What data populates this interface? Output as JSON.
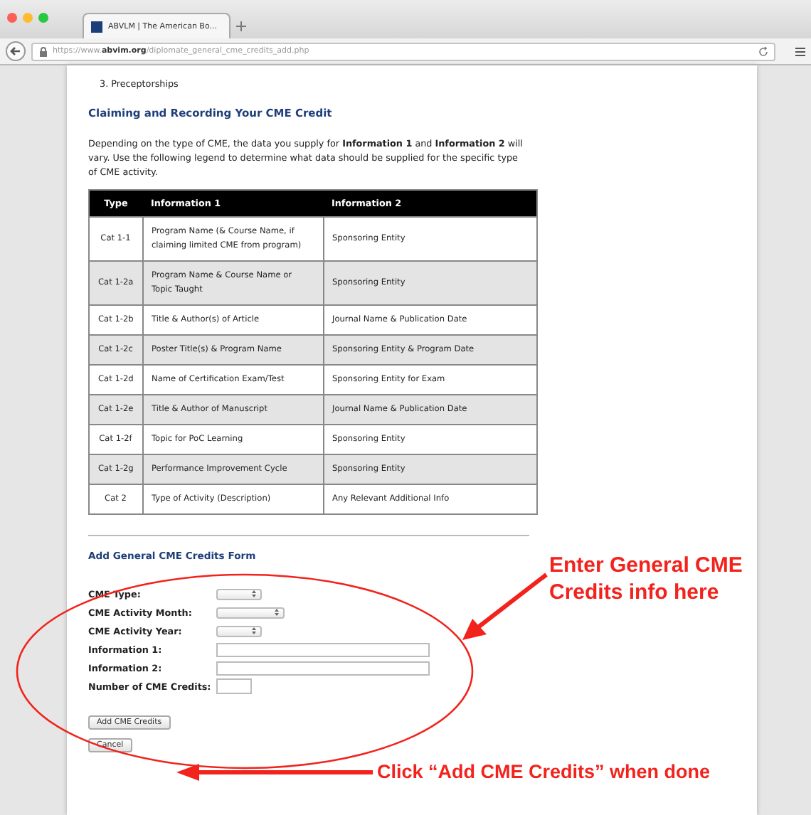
{
  "browser": {
    "tab_title": "ABVLM | The American Bo...",
    "url": "https://www.**abvim.org**/diplomate_general_cme_credits_add.php"
  },
  "page": {
    "list_item": "3. Preceptorships",
    "heading": "Claiming and Recording Your CME Credit",
    "paragraph": "Depending on the type of CME, the data you supply for **Information 1** and **Information 2** will vary. Use the following legend to determine what data should be supplied for the specific type of CME activity.",
    "table": {
      "columns": [
        "Type",
        "Information 1",
        "Information 2"
      ],
      "rows": [
        [
          "Cat 1-1",
          "Program Name (& Course Name, if claiming limited CME from program)",
          "Sponsoring Entity"
        ],
        [
          "Cat 1-2a",
          "Program Name & Course Name or Topic Taught",
          "Sponsoring Entity"
        ],
        [
          "Cat 1-2b",
          "Title & Author(s) of Article",
          "Journal Name & Publication Date"
        ],
        [
          "Cat 1-2c",
          "Poster Title(s) & Program Name",
          "Sponsoring Entity & Program Date"
        ],
        [
          "Cat 1-2d",
          "Name of Certification Exam/Test",
          "Sponsoring Entity for Exam"
        ],
        [
          "Cat 1-2e",
          "Title & Author of Manuscript",
          "Journal Name & Publication Date"
        ],
        [
          "Cat 1-2f",
          "Topic for PoC Learning",
          "Sponsoring Entity"
        ],
        [
          "Cat 1-2g",
          "Performance Improvement Cycle",
          "Sponsoring Entity"
        ],
        [
          "Cat 2",
          "Type of Activity (Description)",
          "Any Relevant Additional Info"
        ]
      ]
    },
    "form": {
      "title": "Add General CME Credits Form",
      "fields": [
        {
          "label": "CME Type:",
          "kind": "select"
        },
        {
          "label": "CME Activity Month:",
          "kind": "select"
        },
        {
          "label": "CME Activity Year:",
          "kind": "select"
        },
        {
          "label": "Information 1:",
          "kind": "text"
        },
        {
          "label": "Information 2:",
          "kind": "text"
        },
        {
          "label": "Number of CME Credits:",
          "kind": "number"
        }
      ],
      "buttons": [
        "Add CME Credits",
        "Cancel"
      ]
    }
  },
  "annotations": [
    {
      "text": "Enter General CME Credits info here"
    },
    {
      "text": "Click “Add CME Credits” when done"
    }
  ]
}
